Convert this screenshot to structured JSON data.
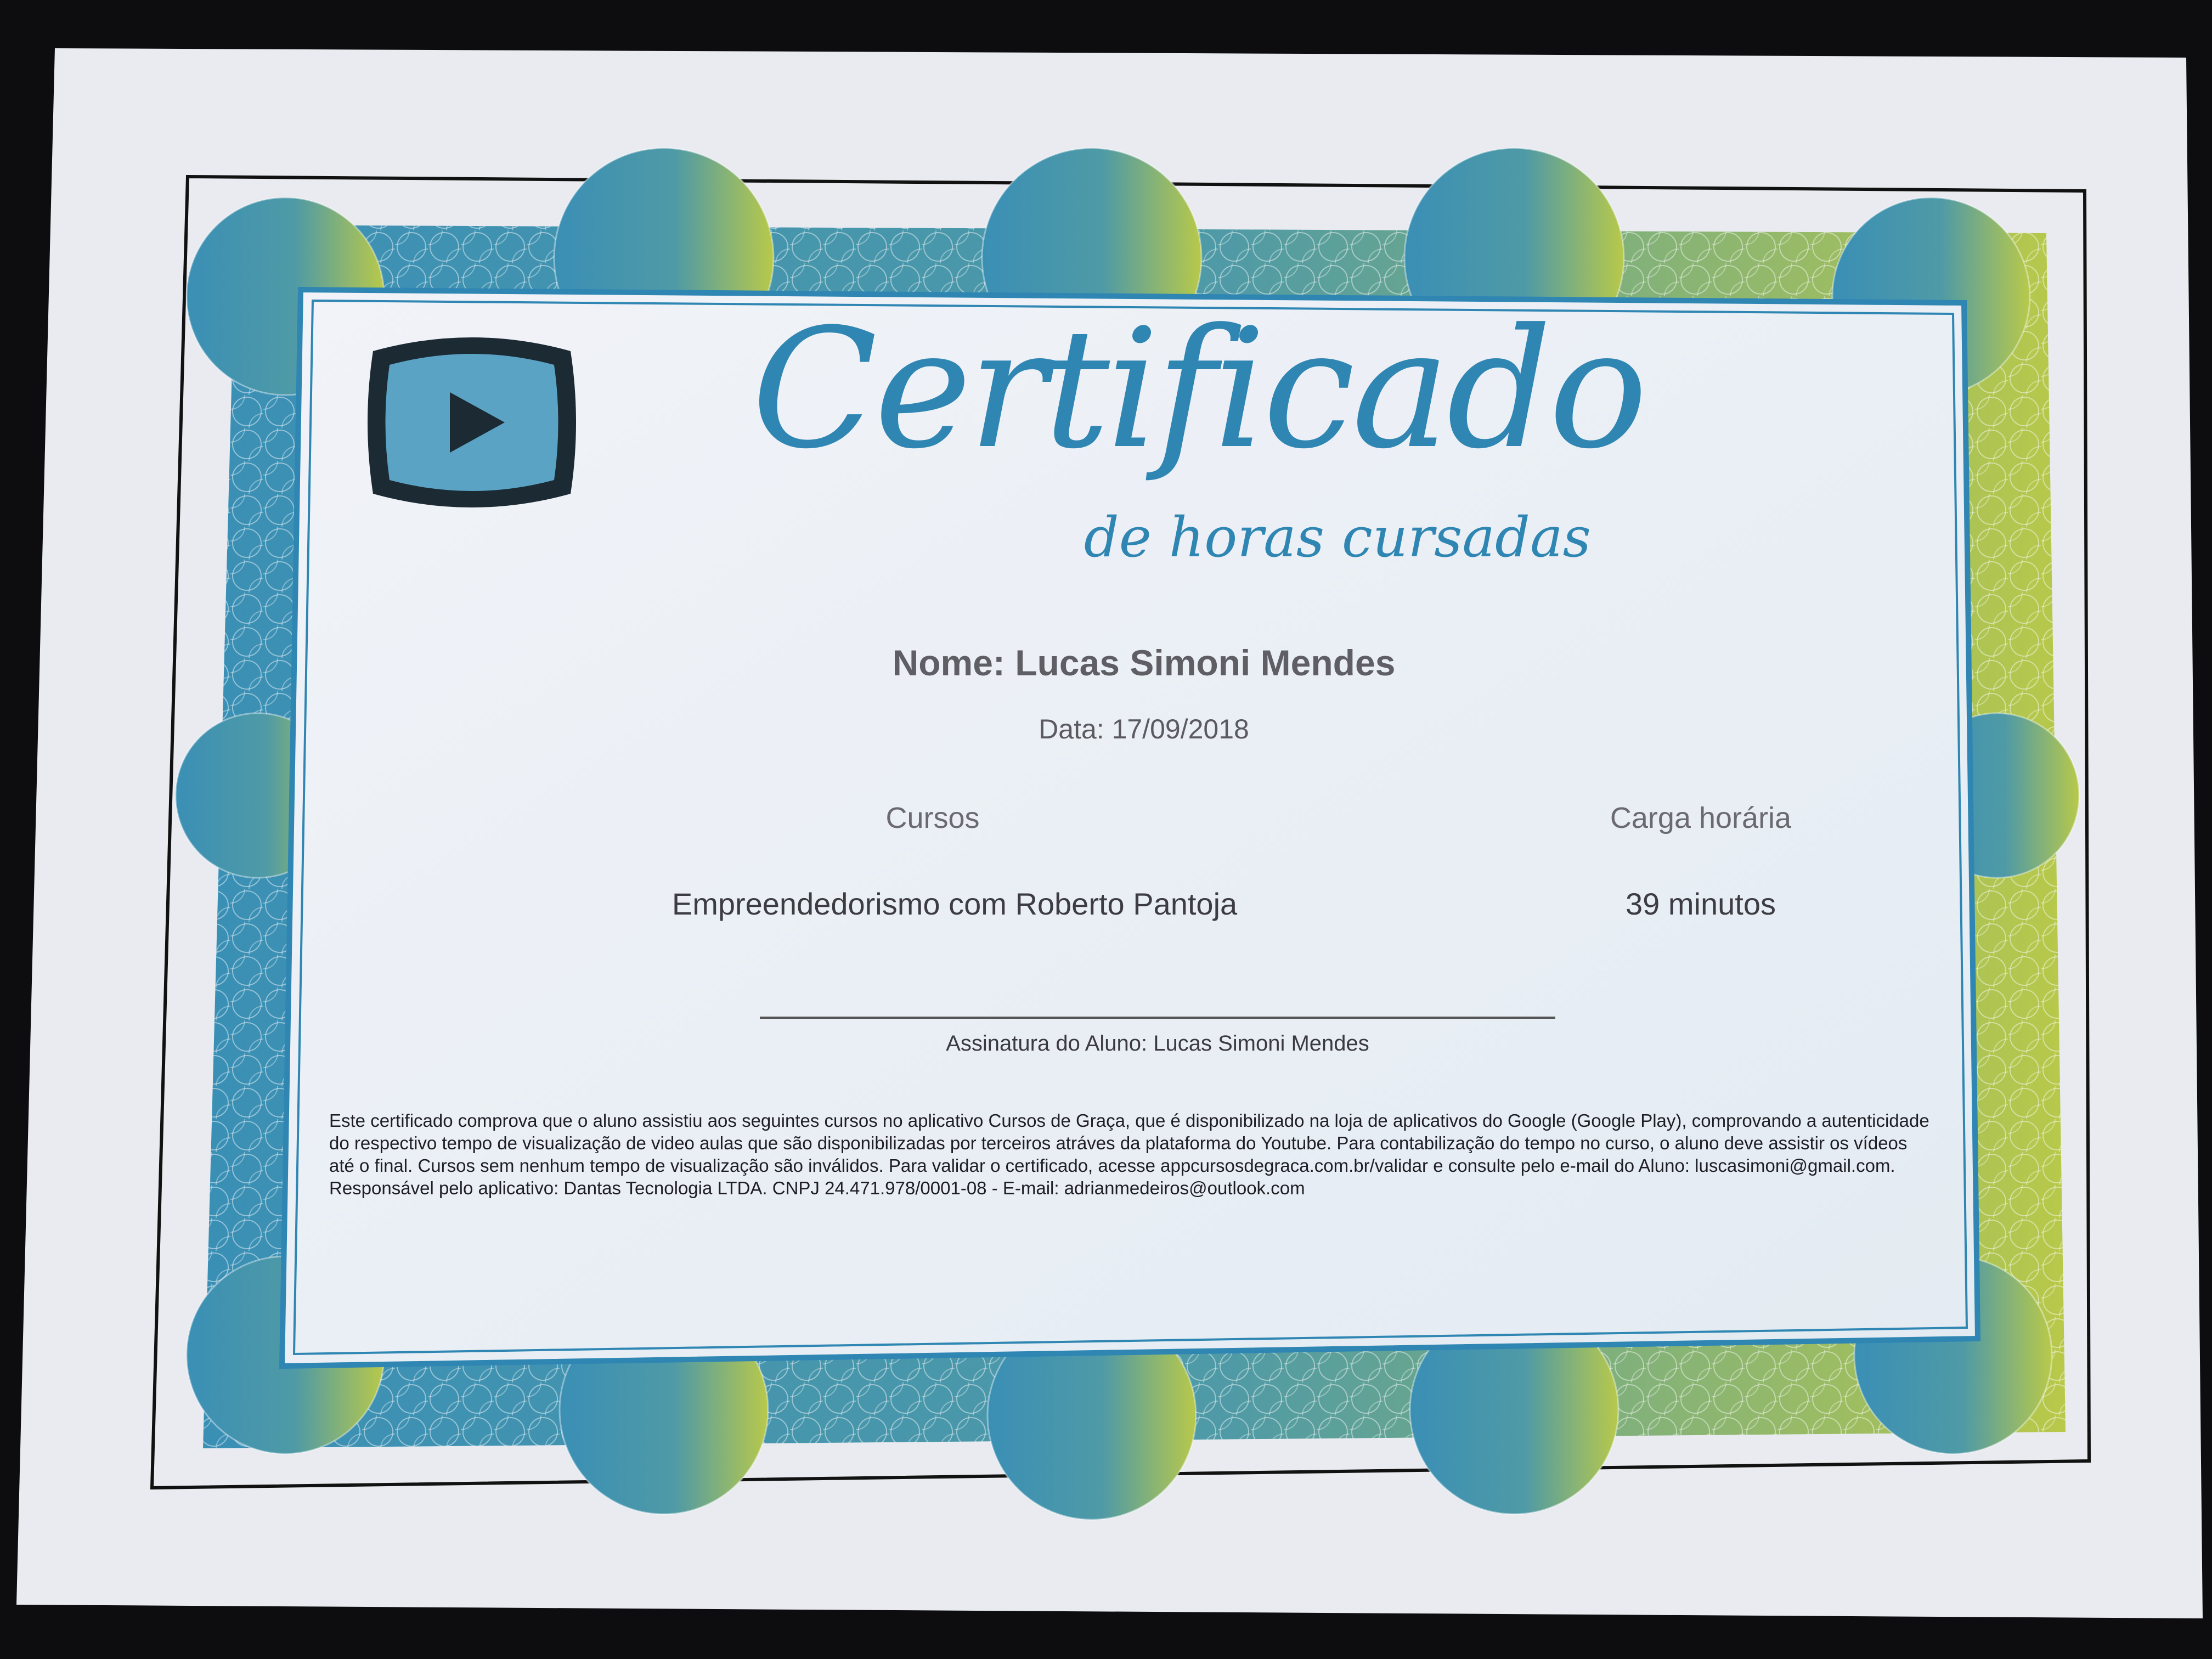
{
  "certificate": {
    "title": "Certificado",
    "subtitle": "de horas cursadas",
    "name_line": "Nome: Lucas Simoni Mendes",
    "date_line": "Data: 17/09/2018",
    "columns": {
      "courses_header": "Cursos",
      "hours_header": "Carga horária"
    },
    "rows": [
      {
        "course": "Empreendedorismo com Roberto Pantoja",
        "hours": "39 minutos"
      }
    ],
    "signature_caption": "Assinatura do Aluno: Lucas Simoni Mendes",
    "legal_text": "Este certificado comprova que o aluno assistiu aos seguintes cursos no aplicativo Cursos de Graça, que é disponibilizado na loja de aplicativos do Google (Google Play), comprovando a autenticidade do respectivo tempo de visualização de video aulas que são disponibilizadas por terceiros atráves da plataforma do Youtube. Para contabilização do tempo no curso, o aluno deve assistir os vídeos até o final. Cursos sem nenhum tempo de visualização são inválidos. Para validar o certificado, acesse appcursosdegraca.com.br/validar e consulte pelo e-mail do Aluno: luscasimoni@gmail.com.",
    "responsible_text": "Responsável pelo aplicativo: Dantas Tecnologia LTDA. CNPJ 24.471.978/0001-08 - E-mail: adrianmedeiros@outlook.com"
  },
  "icons": {
    "logo": "video-play-icon"
  },
  "colors": {
    "border_blue": "#3a8fb5",
    "border_green": "#b8c94a",
    "title_blue": "#2f86b3",
    "paper": "#eef0f6",
    "background": "#0d0d0f"
  }
}
